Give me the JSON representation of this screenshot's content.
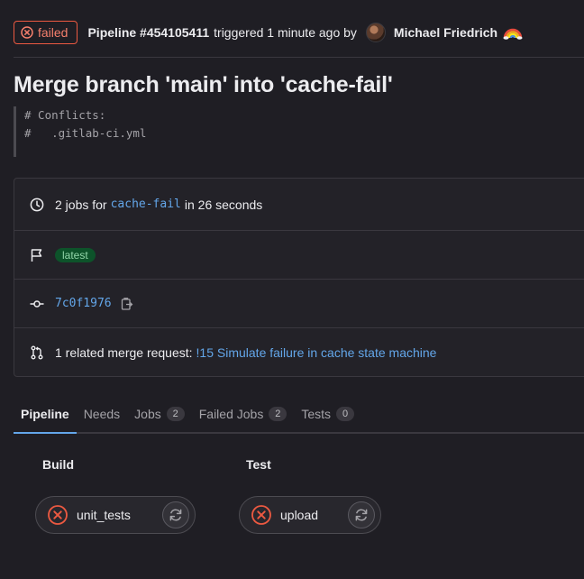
{
  "header": {
    "status": "failed",
    "pipeline_label": "Pipeline #454105411",
    "triggered_text": "triggered 1 minute ago by",
    "author": "Michael Friedrich",
    "author_emoji_icon": "rainbow-icon"
  },
  "title": "Merge branch 'main' into 'cache-fail'",
  "commit_body": [
    "# Conflicts:",
    "#   .gitlab-ci.yml"
  ],
  "info": {
    "jobs_prefix": "2 jobs for",
    "branch": "cache-fail",
    "jobs_suffix": "in 26 seconds",
    "badge": "latest",
    "commit_sha": "7c0f1976",
    "mr_prefix": "1 related merge request:",
    "mr_link": "!15 Simulate failure in cache state machine"
  },
  "tabs": [
    {
      "label": "Pipeline",
      "count": null,
      "active": true
    },
    {
      "label": "Needs",
      "count": null,
      "active": false
    },
    {
      "label": "Jobs",
      "count": "2",
      "active": false
    },
    {
      "label": "Failed Jobs",
      "count": "2",
      "active": false
    },
    {
      "label": "Tests",
      "count": "0",
      "active": false
    }
  ],
  "stages": [
    {
      "name": "Build",
      "job": "unit_tests",
      "status": "failed"
    },
    {
      "name": "Test",
      "job": "upload",
      "status": "failed"
    }
  ],
  "colors": {
    "failed": "#ec5941",
    "link": "#63a6e9",
    "badge_bg": "#0d532a",
    "badge_fg": "#91d4a8",
    "background": "#1f1e24"
  }
}
